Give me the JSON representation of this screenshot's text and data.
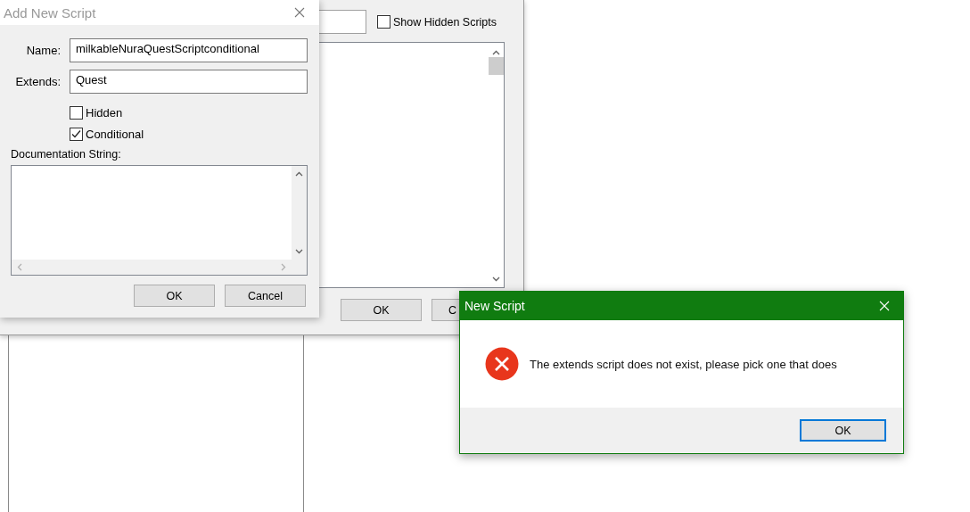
{
  "background_window": {
    "show_hidden_scripts": {
      "label": "Show Hidden Scripts",
      "checked": false
    },
    "buttons": [
      "OK",
      "C"
    ]
  },
  "add_dialog": {
    "title": "Add New Script",
    "active": false,
    "fields": [
      {
        "label": "Name:",
        "value": "milkableNuraQuestScriptconditional"
      },
      {
        "label": "Extends:",
        "value": "Quest"
      }
    ],
    "options": [
      {
        "label": "Hidden",
        "checked": false
      },
      {
        "label": "Conditional",
        "checked": true
      }
    ],
    "doc_label": "Documentation String:",
    "buttons": [
      "OK",
      "Cancel"
    ]
  },
  "message_box": {
    "title": "New Script",
    "message": "The extends script does not exist, please pick one that does",
    "buttons": [
      "OK"
    ]
  }
}
